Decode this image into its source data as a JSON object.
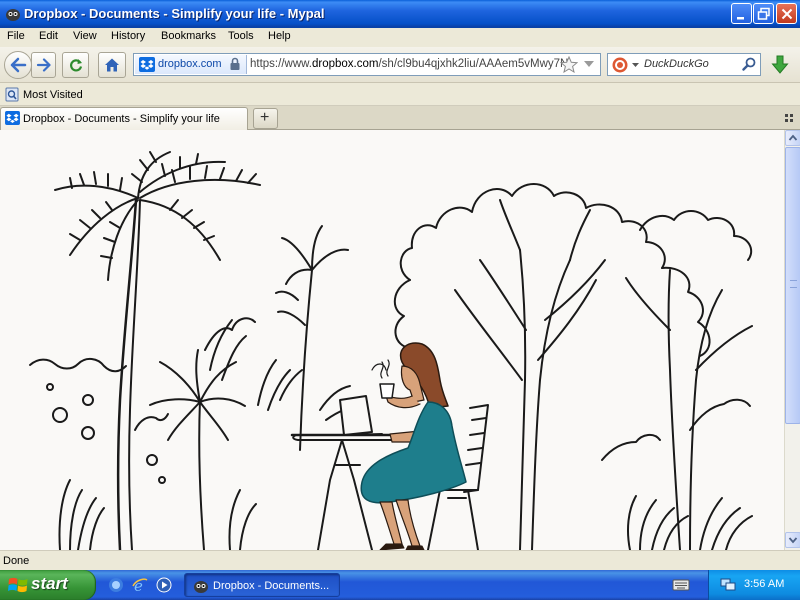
{
  "window": {
    "title": "Dropbox - Documents - Simplify your life - Mypal"
  },
  "menu": {
    "items": [
      {
        "label": "File"
      },
      {
        "label": "Edit"
      },
      {
        "label": "View"
      },
      {
        "label": "History"
      },
      {
        "label": "Bookmarks"
      },
      {
        "label": "Tools"
      },
      {
        "label": "Help"
      }
    ]
  },
  "navbar": {
    "identity_domain": "dropbox.com",
    "url_prefix": "https://www.",
    "url_host": "dropbox.com",
    "url_path": "/sh/cl9bu4qjxhk2liu/AAAem5vMwy7N",
    "search_placeholder": "DuckDuckGo"
  },
  "bookmarks": {
    "most_visited": "Most Visited"
  },
  "tabs": [
    {
      "label": "Dropbox - Documents - Simplify your life",
      "active": true
    }
  ],
  "status": {
    "text": "Done"
  },
  "taskbar": {
    "start_label": "start",
    "task_label": "Dropbox - Documents...",
    "clock": "3:56 AM"
  },
  "colors": {
    "titlebar_blue": "#1E64DE",
    "dropbox_blue": "#0D6CE0",
    "dress_teal": "#1E7E8C",
    "hair_brown": "#8A4A2A",
    "skin": "#D8A27A",
    "start_green": "#369436"
  },
  "icons": {
    "window_app": "mypal-icon",
    "back": "back-arrow-icon",
    "forward": "forward-arrow-icon",
    "reload": "reload-icon",
    "home": "home-icon",
    "site": "dropbox-icon",
    "lock": "lock-icon",
    "bookmark": "star-icon",
    "search_engine": "duckduckgo-icon",
    "download": "download-arrow-icon"
  }
}
